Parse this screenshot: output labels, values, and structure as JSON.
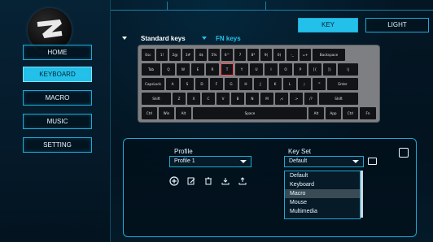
{
  "sidebar": {
    "items": [
      {
        "label": "HOME",
        "active": false
      },
      {
        "label": "KEYBOARD",
        "active": true
      },
      {
        "label": "MACRO",
        "active": false
      },
      {
        "label": "MUSIC",
        "active": false
      },
      {
        "label": "SETTING",
        "active": false
      }
    ]
  },
  "modes": {
    "key": "KEY",
    "light": "LIGHT"
  },
  "layers": {
    "standard": "Standard keys",
    "fn": "FN keys"
  },
  "keyboard": {
    "rows": [
      [
        "Esc",
        "1!",
        "2@",
        "3#",
        "4$",
        "5%",
        "6^",
        "7",
        "8*",
        "9(",
        "0)",
        "-_",
        "=+",
        "Backspace"
      ],
      [
        "Tab",
        "Q",
        "W",
        "E",
        "R",
        "T",
        "Y",
        "U",
        "I",
        "O",
        "P",
        "[{",
        "]}",
        "\\|"
      ],
      [
        "CapsLock",
        "A",
        "S",
        "D",
        "F",
        "G",
        "H",
        "J",
        "K",
        "L",
        ";:",
        "'\"",
        "Enter"
      ],
      [
        "Shift",
        "Z",
        "X",
        "C",
        "V",
        "B",
        "N",
        "M",
        ",<",
        ".>",
        "/?",
        "Shift"
      ],
      [
        "Ctrl",
        "Win",
        "Alt",
        "Space",
        "Alt",
        "App",
        "Ctrl",
        "Fn"
      ]
    ]
  },
  "profile": {
    "label": "Profile",
    "value": "Profile 1"
  },
  "keyset": {
    "label": "Key Set",
    "value": "Default",
    "options": [
      "Default",
      "Keyboard",
      "Macro",
      "Mouse",
      "Multimedia"
    ],
    "highlighted": "Macro"
  },
  "icons": {
    "actions": [
      "add-icon",
      "edit-icon",
      "delete-icon",
      "import-icon",
      "export-icon"
    ],
    "save": "save-icon",
    "preview": "monitor-icon"
  },
  "colors": {
    "accent": "#23c1ea",
    "border": "#1fa8d6",
    "background": "#03101b",
    "keycap": "#111316",
    "keyboard_frame": "#7d7f82",
    "key_highlight": "#ff4a4a"
  }
}
